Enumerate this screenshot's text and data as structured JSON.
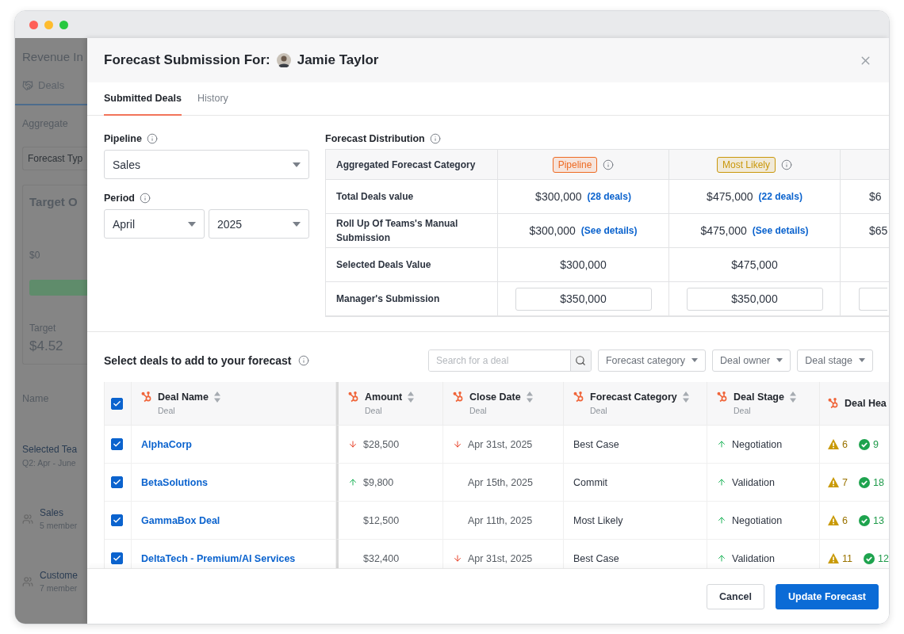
{
  "window": {
    "buttons": [
      {
        "color": "#ff5f57"
      },
      {
        "color": "#febc2e"
      },
      {
        "color": "#28c840"
      }
    ]
  },
  "background_app": {
    "title": "Revenue In",
    "nav_tab": "Deals",
    "filter_label": "Aggregate",
    "field_placeholder": "Forecast Typ",
    "card_title": "Target O",
    "axis_label": "$0",
    "target_label": "Target",
    "target_value": "$4.52",
    "column_header": "Name",
    "selected_team": "Selected Tea",
    "period": "Q2: Apr - June",
    "teams": [
      {
        "name": "Sales",
        "members": "5 member"
      },
      {
        "name": "Custome",
        "members": "7 member"
      }
    ]
  },
  "modal": {
    "title": "Forecast Submission For:",
    "user": "Jamie Taylor",
    "tabs": [
      {
        "label": "Submitted Deals",
        "selected": true
      },
      {
        "label": "History",
        "selected": false
      }
    ],
    "pipeline": {
      "label": "Pipeline",
      "value": "Sales"
    },
    "period": {
      "label": "Period",
      "month": "April",
      "year": "2025"
    },
    "distribution": {
      "title": "Forecast Distribution",
      "header_label": "Aggregated Forecast Category",
      "categories": [
        {
          "label": "Pipeline",
          "color": "#ee6a23"
        },
        {
          "label": "Most Likely",
          "color": "#c9970a"
        }
      ],
      "rows": [
        {
          "kind": "link",
          "label": "Total Deals value",
          "cells": [
            {
              "value": "$300,000",
              "link": "(28 deals)"
            },
            {
              "value": "$475,000",
              "link": "(22 deals)"
            },
            {
              "value": "$6"
            }
          ]
        },
        {
          "kind": "link",
          "label": "Roll Up Of Teams's Manual Submission",
          "cells": [
            {
              "value": "$300,000",
              "link": "(See details)"
            },
            {
              "value": "$475,000",
              "link": "(See details)"
            },
            {
              "value": "$65"
            }
          ]
        },
        {
          "kind": "text",
          "label": "Selected Deals Value",
          "cells": [
            {
              "value": "$300,000"
            },
            {
              "value": "$475,000"
            },
            {}
          ]
        },
        {
          "kind": "input",
          "label": "Manager's Submission",
          "cells": [
            {
              "value": "$350,000"
            },
            {
              "value": "$350,000"
            },
            {}
          ]
        }
      ]
    },
    "deals": {
      "title": "Select deals to add to your forecast",
      "search_placeholder": "Search for a deal",
      "filters": [
        "Forecast category",
        "Deal owner",
        "Deal stage"
      ],
      "all_checked": true,
      "columns": [
        {
          "label": "Deal Name",
          "sub": "Deal"
        },
        {
          "label": "Amount",
          "sub": "Deal"
        },
        {
          "label": "Close Date",
          "sub": "Deal"
        },
        {
          "label": "Forecast Category",
          "sub": "Deal"
        },
        {
          "label": "Deal Stage",
          "sub": "Deal"
        },
        {
          "label": "Deal Hea"
        }
      ],
      "rows": [
        {
          "checked": true,
          "name": "AlphaCorp",
          "amount": "$28,500",
          "amount_trend": {
            "kind": "down"
          },
          "close_date": "Apr 31st, 2025",
          "date_trend": {
            "kind": "down"
          },
          "category": "Best Case",
          "stage": "Negotiation",
          "stage_trend": {
            "kind": "up"
          },
          "warnings": "6",
          "passes": "9"
        },
        {
          "checked": true,
          "name": "BetaSolutions",
          "amount": "$9,800",
          "amount_trend": {
            "kind": "up"
          },
          "close_date": "Apr 15th, 2025",
          "category": "Commit",
          "stage": "Validation",
          "stage_trend": {
            "kind": "up"
          },
          "warnings": "7",
          "passes": "18"
        },
        {
          "checked": true,
          "name": "GammaBox Deal",
          "amount": "$12,500",
          "close_date": "Apr 11th, 2025",
          "category": "Most Likely",
          "stage": "Negotiation",
          "stage_trend": {
            "kind": "up"
          },
          "warnings": "6",
          "passes": "13"
        },
        {
          "checked": true,
          "name": "DeltaTech - Premium/AI Services",
          "amount": "$32,400",
          "close_date": "Apr 31st, 2025",
          "date_trend": {
            "kind": "down"
          },
          "category": "Best Case",
          "stage": "Validation",
          "stage_trend": {
            "kind": "up"
          },
          "warnings": "11",
          "passes": "12"
        }
      ]
    },
    "footer": {
      "cancel": "Cancel",
      "submit": "Update Forecast"
    }
  }
}
